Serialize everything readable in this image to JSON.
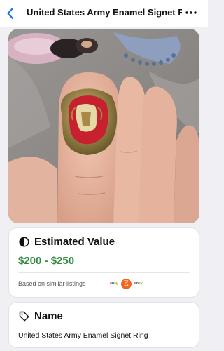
{
  "header": {
    "title": "United States Army Enamel Signet Ring",
    "back_icon": "chevron-left-icon",
    "more_icon": "ellipsis-icon"
  },
  "photo": {
    "subject": "gold signet ring with enamel eagle crest worn on finger"
  },
  "estimated_value": {
    "heading": "Estimated Value",
    "icon": "half-circle-icon",
    "price_range": "$200 - $250",
    "price_color": "#2f8a3c",
    "based_on": "Based on similar listings",
    "sources": [
      {
        "name": "ebay",
        "icon": "ebay-logo"
      },
      {
        "name": "E",
        "icon": "etsy-logo",
        "color": "#f1641e"
      },
      {
        "name": "ebay",
        "icon": "ebay-logo"
      }
    ]
  },
  "name_section": {
    "heading": "Name",
    "icon": "tag-icon",
    "value": "United States Army Enamel Signet Ring"
  },
  "colors": {
    "accent_back": "#1a73e8",
    "background": "#efeff4"
  }
}
